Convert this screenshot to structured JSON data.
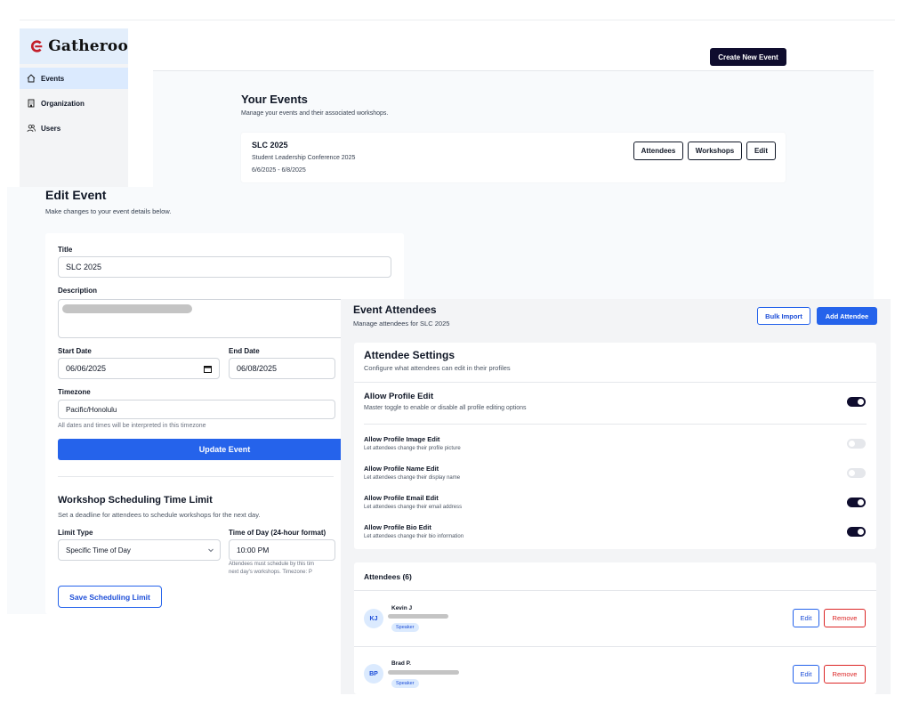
{
  "app": {
    "name": "Gatheroo"
  },
  "sidebar": {
    "items": [
      {
        "label": "Events",
        "icon": "home-icon",
        "active": true
      },
      {
        "label": "Organization",
        "icon": "building-icon",
        "active": false
      },
      {
        "label": "Users",
        "icon": "users-icon",
        "active": false
      }
    ]
  },
  "header": {
    "create_button": "Create New Event"
  },
  "events": {
    "title": "Your Events",
    "subtitle": "Manage your events and their associated workshops.",
    "list": [
      {
        "name": "SLC 2025",
        "full_name": "Student Leadership Conference 2025",
        "dates": "6/6/2025 - 6/8/2025",
        "buttons": [
          "Attendees",
          "Workshops",
          "Edit"
        ]
      }
    ]
  },
  "edit_event": {
    "title": "Edit Event",
    "subtitle": "Make changes to your event details below.",
    "title_label": "Title",
    "title_value": "SLC 2025",
    "description_label": "Description",
    "start_label": "Start Date",
    "start_value": "06/06/2025",
    "end_label": "End Date",
    "end_value": "06/08/2025",
    "timezone_label": "Timezone",
    "timezone_value": "Pacific/Honolulu",
    "timezone_hint": "All dates and times will be interpreted in this timezone",
    "update_button": "Update Event",
    "workshop_title": "Workshop Scheduling Time Limit",
    "workshop_sub": "Set a deadline for attendees to schedule workshops for the next day.",
    "limit_type_label": "Limit Type",
    "limit_type_value": "Specific Time of Day",
    "time_label": "Time of Day (24-hour format)",
    "time_value": "10:00 PM",
    "time_hint_line1": "Attendees must schedule by this tim",
    "time_hint_line2": "next day's workshops. Timezone: P",
    "save_button": "Save Scheduling Limit"
  },
  "attendees_panel": {
    "title": "Event Attendees",
    "subtitle": "Manage attendees for SLC 2025",
    "bulk_button": "Bulk Import",
    "add_button": "Add Attendee",
    "settings_title": "Attendee Settings",
    "settings_sub": "Configure what attendees can edit in their profiles",
    "master": {
      "title": "Allow Profile Edit",
      "sub": "Master toggle to enable or disable all profile editing options",
      "on": true
    },
    "options": [
      {
        "title": "Allow Profile Image Edit",
        "sub": "Let attendees change their profile picture",
        "on": false
      },
      {
        "title": "Allow Profile Name Edit",
        "sub": "Let attendees change their display name",
        "on": false
      },
      {
        "title": "Allow Profile Email Edit",
        "sub": "Let attendees change their email address",
        "on": true
      },
      {
        "title": "Allow Profile Bio Edit",
        "sub": "Let attendees change their bio information",
        "on": true
      }
    ],
    "list_title": "Attendees (6)",
    "attendees": [
      {
        "initials": "KJ",
        "name": "Kevin J",
        "badge": "Speaker",
        "edit": "Edit",
        "remove": "Remove"
      },
      {
        "initials": "BP",
        "name": "Brad P.",
        "badge": "Speaker",
        "edit": "Edit",
        "remove": "Remove"
      }
    ]
  },
  "colors": {
    "primary": "#2563eb",
    "dark": "#0f0d2e",
    "danger": "#dc2626",
    "logo": "#c41e2a"
  }
}
